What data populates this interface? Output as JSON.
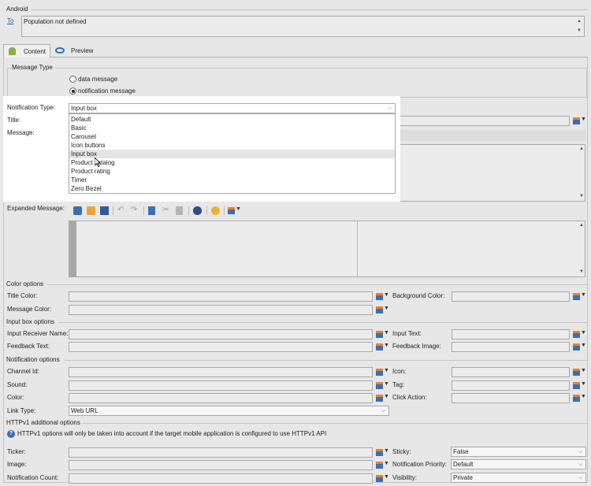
{
  "android": {
    "title": "Android",
    "to_link": "To",
    "population": "Population not defined"
  },
  "tabs": [
    {
      "label": "Content",
      "icon": "android-icon"
    },
    {
      "label": "Preview",
      "icon": "eye-icon"
    }
  ],
  "message_type": {
    "legend": "Message Type",
    "options": [
      "data message",
      "notification message"
    ],
    "selected": "notification message"
  },
  "notification_type": {
    "label": "Notification Type:",
    "value": "Input box",
    "options": [
      "Default",
      "Basic",
      "Carousel",
      "Icon buttons",
      "Input box",
      "Product catalog",
      "Product rating",
      "Timer",
      "Zero Bezel"
    ],
    "highlighted": "Input box"
  },
  "title_label": "Title:",
  "message_label": "Message:",
  "expanded_message_label": "Expanded Message:",
  "color_options": {
    "legend": "Color options",
    "title_color": "Title Color:",
    "background_color": "Background Color:",
    "message_color": "Message Color:"
  },
  "input_box_options": {
    "legend": "Input box options",
    "input_receiver_name": "Input Receiver Name:",
    "input_text": "Input Text:",
    "feedback_text": "Feedback Text:",
    "feedback_image": "Feedback Image:"
  },
  "notification_options": {
    "legend": "Notification options",
    "channel_id": "Channel Id:",
    "icon": "Icon:",
    "sound": "Sound:",
    "tag": "Tag:",
    "color": "Color:",
    "click_action": "Click Action:",
    "link_type_label": "Link Type:",
    "link_type_value": "Web URL"
  },
  "httpv1": {
    "legend": "HTTPv1 additional options",
    "info": "HTTPv1 options will only be taken into account if the target mobile application is configured to use HTTPv1 API",
    "ticker": "Ticker:",
    "image": "Image:",
    "notification_count": "Notification Count:",
    "sticky_label": "Sticky:",
    "sticky_value": "False",
    "priority_label": "Notification Priority:",
    "priority_value": "Default",
    "visibility_label": "Visibility:",
    "visibility_value": "Private"
  },
  "colors": {
    "accent": "#3c6fb0",
    "link": "#1a5fb4",
    "highlight": "#e5e5e5"
  }
}
